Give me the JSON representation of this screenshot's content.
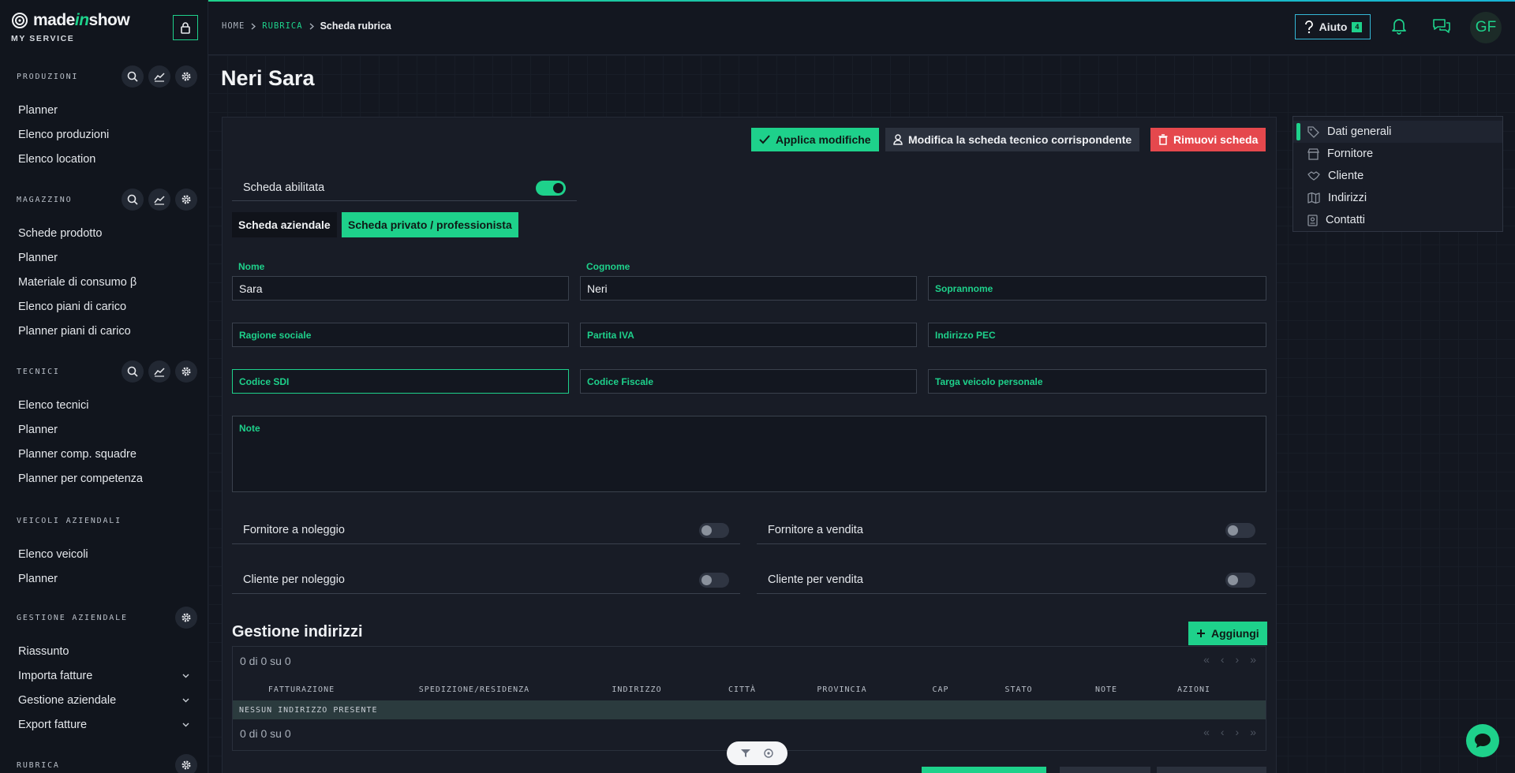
{
  "brand": {
    "name_a": "made",
    "name_b": "in",
    "name_c": "show",
    "subtitle": "MY SERVICE"
  },
  "sidebar": {
    "sections": [
      {
        "title": "PRODUZIONI",
        "items": [
          "Planner",
          "Elenco produzioni",
          "Elenco location"
        ]
      },
      {
        "title": "MAGAZZINO",
        "items": [
          "Schede prodotto",
          "Planner",
          "Materiale di consumo β",
          "Elenco piani di carico",
          "Planner piani di carico"
        ]
      },
      {
        "title": "TECNICI",
        "items": [
          "Elenco tecnici",
          "Planner",
          "Planner comp. squadre",
          "Planner per competenza"
        ]
      },
      {
        "title": "VEICOLI AZIENDALI",
        "items": [
          "Elenco veicoli",
          "Planner"
        ]
      },
      {
        "title": "GESTIONE AZIENDALE",
        "items": [
          "Riassunto",
          "Importa fatture",
          "Gestione aziendale",
          "Export fatture"
        ]
      },
      {
        "title": "RUBRICA",
        "items": []
      }
    ]
  },
  "breadcrumb": {
    "home": "HOME",
    "rubrica": "RUBRICA",
    "current": "Scheda rubrica"
  },
  "header": {
    "help_label": "Aiuto",
    "help_badge": "4",
    "avatar_initials": "GF"
  },
  "page": {
    "title": "Neri Sara"
  },
  "actions": {
    "apply": "Applica modifiche",
    "edit_tech": "Modifica la scheda tecnico corrispondente",
    "remove": "Rimuovi scheda"
  },
  "toggles": {
    "enabled_label": "Scheda abilitata",
    "enabled": true
  },
  "tabs": {
    "company": "Scheda aziendale",
    "private": "Scheda privato / professionista"
  },
  "form": {
    "nome_label": "Nome",
    "nome_value": "Sara",
    "cognome_label": "Cognome",
    "cognome_value": "Neri",
    "soprannome_label": "Soprannome",
    "ragione_label": "Ragione sociale",
    "piva_label": "Partita IVA",
    "pec_label": "Indirizzo PEC",
    "sdi_label": "Codice SDI",
    "cf_label": "Codice Fiscale",
    "targa_label": "Targa veicolo personale",
    "note_label": "Note"
  },
  "flags": {
    "fornitore_noleggio": "Fornitore a noleggio",
    "fornitore_vendita": "Fornitore a vendita",
    "cliente_noleggio": "Cliente per noleggio",
    "cliente_vendita": "Cliente per vendita"
  },
  "addresses": {
    "title": "Gestione indirizzi",
    "add_label": "Aggiungi",
    "count_top": "0 di 0 su 0",
    "count_bottom": "0 di 0 su 0",
    "columns": [
      "FATTURAZIONE",
      "SPEDIZIONE/RESIDENZA",
      "INDIRIZZO",
      "CITTÀ",
      "PROVINCIA",
      "CAP",
      "STATO",
      "NOTE",
      "AZIONI"
    ],
    "empty": "NESSUN INDIRIZZO PRESENTE"
  },
  "index": {
    "items": [
      "Dati generali",
      "Fornitore",
      "Cliente",
      "Indirizzi",
      "Contatti"
    ]
  },
  "colors": {
    "accent": "#1ed18b",
    "danger": "#e5484d",
    "info": "#34b7d6",
    "background": "#131720"
  }
}
